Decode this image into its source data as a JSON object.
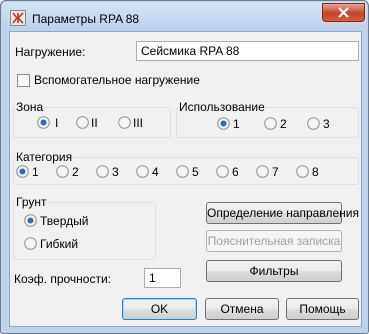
{
  "window": {
    "title": "Параметры RPA 88"
  },
  "load": {
    "label": "Нагружение:",
    "value": "Сейсмика RPA 88"
  },
  "auxiliary": {
    "label": "Вспомогательное нагружение",
    "checked": false
  },
  "zone": {
    "title": "Зона",
    "options": [
      "I",
      "II",
      "III"
    ],
    "selected": "I"
  },
  "usage": {
    "title": "Использование",
    "options": [
      "1",
      "2",
      "3"
    ],
    "selected": "1"
  },
  "category": {
    "title": "Категория",
    "options": [
      "1",
      "2",
      "3",
      "4",
      "5",
      "6",
      "7",
      "8"
    ],
    "selected": "1"
  },
  "soil": {
    "title": "Грунт",
    "options": [
      "Твердый",
      "Гибкий"
    ],
    "selected": "Твердый"
  },
  "buttons": {
    "direction": "Определение направления",
    "note": "Пояснительная записка",
    "filters": "Фильтры",
    "ok": "OK",
    "cancel": "Отмена",
    "help": "Помощь"
  },
  "strength": {
    "label": "Коэф. прочности:",
    "value": "1"
  }
}
